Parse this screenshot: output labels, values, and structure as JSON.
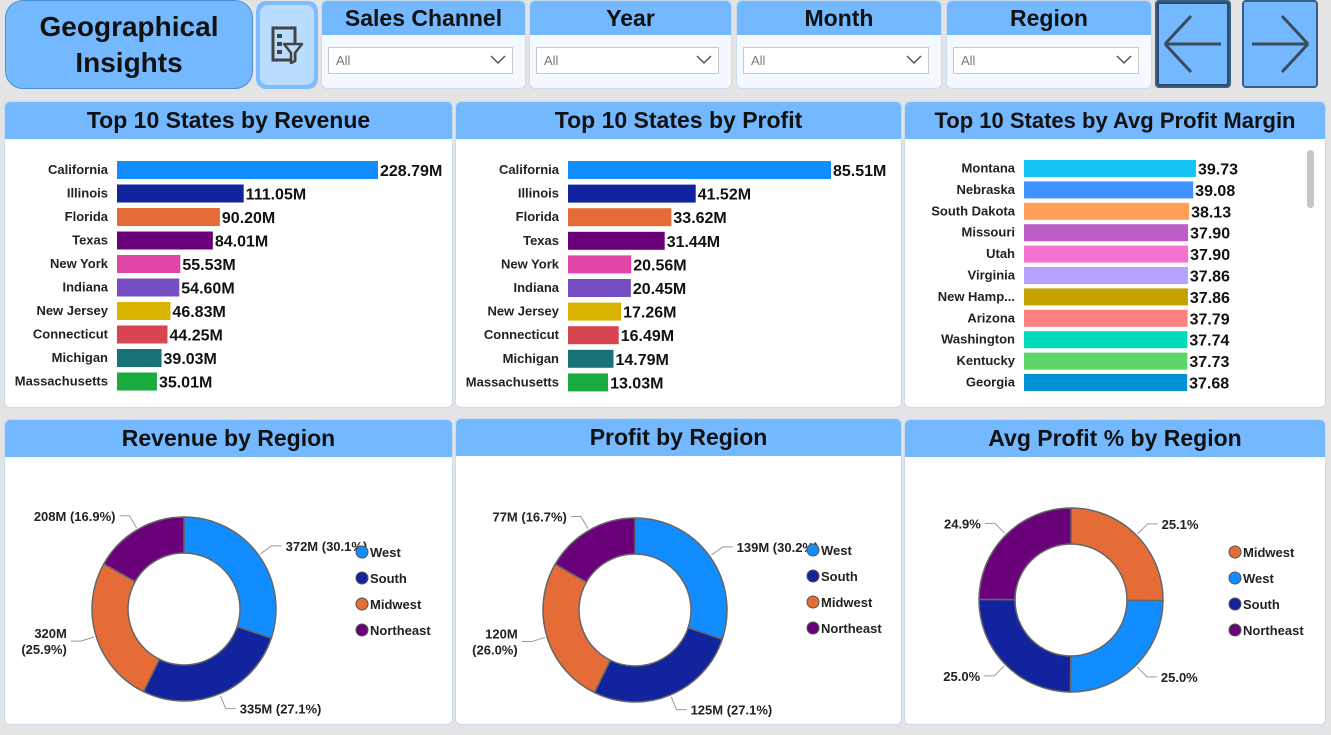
{
  "header": {
    "title": "Geographical\nInsights",
    "filter_icon": "filter-panel-icon",
    "slicers": [
      {
        "label": "Sales Channel",
        "value": "All"
      },
      {
        "label": "Year",
        "value": "All"
      },
      {
        "label": "Month",
        "value": "All"
      },
      {
        "label": "Region",
        "value": "All"
      }
    ],
    "nav_back_icon": "arrow-left-icon",
    "nav_forward_icon": "arrow-right-icon"
  },
  "colors": {
    "header_bg": "#74b9ff",
    "palette": [
      "#118dff",
      "#12239e",
      "#e66c37",
      "#6b007b",
      "#e044a7",
      "#744ec2",
      "#d9b300",
      "#d64550",
      "#197278",
      "#1aab40"
    ],
    "margin_palette": [
      "#15c6f4",
      "#4092ff",
      "#ffa058",
      "#be5dc9",
      "#f472d0",
      "#b5a1ff",
      "#c4a200",
      "#ff8080",
      "#00dbbc",
      "#5bd667",
      "#0092d4"
    ],
    "region": {
      "West": "#118dff",
      "South": "#12239e",
      "Midwest": "#e66c37",
      "Northeast": "#6b007b"
    }
  },
  "chart_data": [
    {
      "type": "bar",
      "orientation": "horizontal",
      "title": "Top 10 States by Revenue",
      "categories": [
        "California",
        "Illinois",
        "Florida",
        "Texas",
        "New York",
        "Indiana",
        "New Jersey",
        "Connecticut",
        "Michigan",
        "Massachusetts"
      ],
      "values": [
        228.79,
        111.05,
        90.2,
        84.01,
        55.53,
        54.6,
        46.83,
        44.25,
        39.03,
        35.01
      ],
      "labels": [
        "228.79M",
        "111.05M",
        "90.20M",
        "84.01M",
        "55.53M",
        "54.60M",
        "46.83M",
        "44.25M",
        "39.03M",
        "35.01M"
      ],
      "unit": "M",
      "xlim": [
        0,
        228.79
      ],
      "grid": false,
      "legend": "none"
    },
    {
      "type": "bar",
      "orientation": "horizontal",
      "title": "Top 10 States by Profit",
      "categories": [
        "California",
        "Illinois",
        "Florida",
        "Texas",
        "New York",
        "Indiana",
        "New Jersey",
        "Connecticut",
        "Michigan",
        "Massachusetts"
      ],
      "values": [
        85.51,
        41.52,
        33.62,
        31.44,
        20.56,
        20.45,
        17.26,
        16.49,
        14.79,
        13.03
      ],
      "labels": [
        "85.51M",
        "41.52M",
        "33.62M",
        "31.44M",
        "20.56M",
        "20.45M",
        "17.26M",
        "16.49M",
        "14.79M",
        "13.03M"
      ],
      "unit": "M",
      "xlim": [
        0,
        85.51
      ],
      "grid": false,
      "legend": "none"
    },
    {
      "type": "bar",
      "orientation": "horizontal",
      "title": "Top 10 States by Avg Profit Margin",
      "categories": [
        "Montana",
        "Nebraska",
        "South Dakota",
        "Missouri",
        "Utah",
        "Virginia",
        "New Hamp...",
        "Arizona",
        "Washington",
        "Kentucky",
        "Georgia"
      ],
      "values": [
        39.73,
        39.08,
        38.13,
        37.9,
        37.9,
        37.86,
        37.86,
        37.79,
        37.74,
        37.73,
        37.68
      ],
      "labels": [
        "39.73",
        "39.08",
        "38.13",
        "37.90",
        "37.90",
        "37.86",
        "37.86",
        "37.79",
        "37.74",
        "37.73",
        "37.68"
      ],
      "xlim": [
        0,
        39.73
      ],
      "grid": false,
      "legend": "none",
      "scrollable": true
    },
    {
      "type": "pie",
      "donut": true,
      "title": "Revenue by Region",
      "categories": [
        "West",
        "South",
        "Midwest",
        "Northeast"
      ],
      "values": [
        372,
        335,
        320,
        208
      ],
      "labels": [
        "372M (30.1%)",
        "335M (27.1%)",
        "320M\n(25.9%)",
        "208M (16.9%)"
      ],
      "legend": "right"
    },
    {
      "type": "pie",
      "donut": true,
      "title": "Profit by Region",
      "categories": [
        "West",
        "South",
        "Midwest",
        "Northeast"
      ],
      "values": [
        139,
        125,
        120,
        77
      ],
      "labels": [
        "139M (30.2%)",
        "125M (27.1%)",
        "120M\n(26.0%)",
        "77M (16.7%)"
      ],
      "legend": "right"
    },
    {
      "type": "pie",
      "donut": true,
      "title": "Avg Profit % by Region",
      "categories": [
        "Midwest",
        "West",
        "South",
        "Northeast"
      ],
      "values": [
        25.1,
        25.0,
        25.0,
        24.9
      ],
      "labels": [
        "25.1%",
        "25.0%",
        "25.0%",
        "24.9%"
      ],
      "legend": "right"
    }
  ]
}
